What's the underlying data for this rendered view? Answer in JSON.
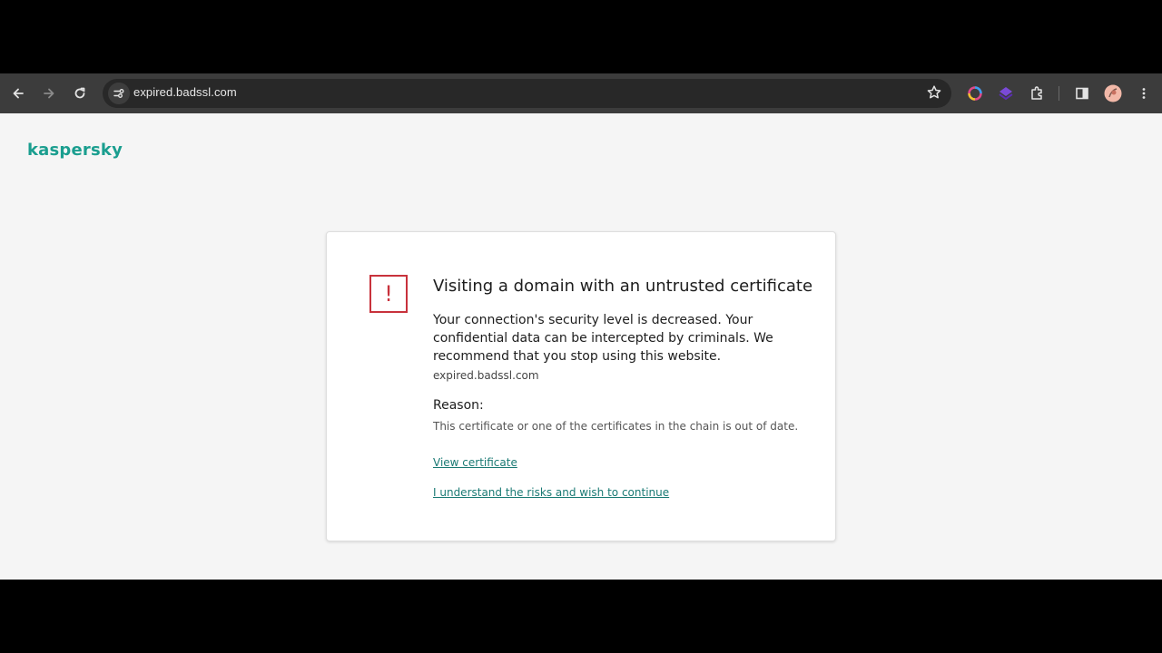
{
  "browser": {
    "url": "expired.badssl.com",
    "icons": [
      "back-icon",
      "forward-icon",
      "reload-icon",
      "site-info-icon",
      "bookmark-star-icon",
      "extension-colorful-icon",
      "extension-purple-icon",
      "extensions-puzzle-icon",
      "side-panel-icon",
      "profile-avatar",
      "menu-kebab-icon"
    ]
  },
  "page": {
    "logo": "kaspersky",
    "brand_color": "#1a9e8f",
    "warning_color": "#c8323c",
    "warning_symbol": "!",
    "title": "Visiting a domain with an untrusted certificate",
    "description": "Your connection's security level is decreased. Your confidential data can be intercepted by criminals. We recommend that you stop using this website.",
    "domain": "expired.badssl.com",
    "reason_label": "Reason:",
    "reason_text": "This certificate or one of the certificates in the chain is out of date.",
    "view_certificate": "View certificate",
    "continue_link": "I understand the risks and wish to continue"
  }
}
